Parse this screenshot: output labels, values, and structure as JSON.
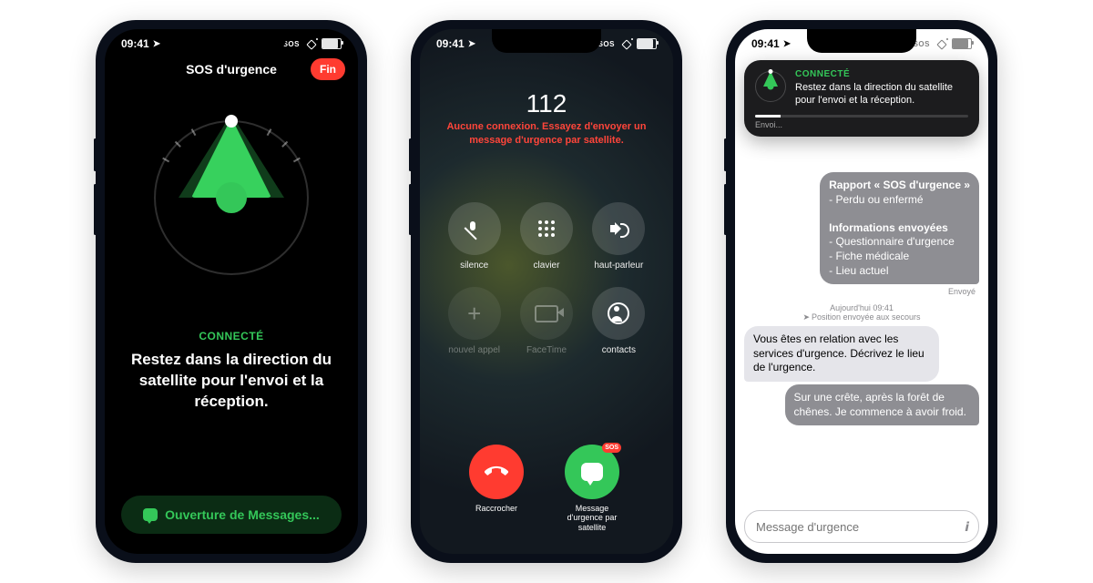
{
  "status": {
    "time": "09:41",
    "sos_indicator": "SOS"
  },
  "screen1": {
    "nav_title": "SOS d'urgence",
    "end_label": "Fin",
    "connected": "CONNECTÉ",
    "instruction": "Restez dans la direction du satellite pour l'envoi et la réception.",
    "open_messages": "Ouverture de Messages..."
  },
  "screen2": {
    "number": "112",
    "no_connection": "Aucune connexion. Essayez d'envoyer un message d'urgence par satellite.",
    "buttons": {
      "mute": "silence",
      "keypad": "clavier",
      "speaker": "haut-parleur",
      "add": "nouvel appel",
      "facetime": "FaceTime",
      "contacts": "contacts"
    },
    "hangup": "Raccrocher",
    "sat_msg": "Message d'urgence par satellite",
    "sos_badge": "SOS"
  },
  "screen3": {
    "banner": {
      "connected": "CONNECTÉ",
      "msg": "Restez dans la direction du satellite pour l'envoi et la réception.",
      "progress_label": "Envoi..."
    },
    "report_title": "Rapport « SOS d'urgence »",
    "report_line1": "- Perdu ou enfermé",
    "info_title": "Informations envoyées",
    "info_l1": "- Questionnaire d'urgence",
    "info_l2": "- Fiche médicale",
    "info_l3": "- Lieu actuel",
    "sent": "Envoyé",
    "ts_line1": "Aujourd'hui 09:41",
    "ts_line2": "Position envoyée aux secours",
    "incoming": "Vous êtes en relation avec les services d'urgence. Décrivez le lieu de l'urgence.",
    "outgoing": "Sur une crête, après la forêt de chênes. Je commence à avoir froid.",
    "input_placeholder": "Message d'urgence"
  }
}
